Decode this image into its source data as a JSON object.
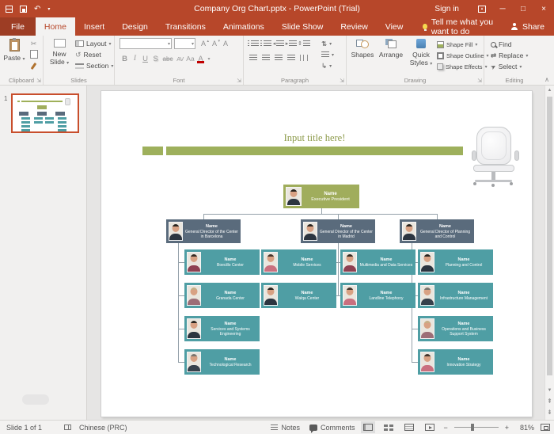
{
  "titlebar": {
    "title": "Company Org Chart.pptx  -  PowerPoint (Trial)",
    "sign_in": "Sign in"
  },
  "tabs": {
    "file": "File",
    "items": [
      "Home",
      "Insert",
      "Design",
      "Transitions",
      "Animations",
      "Slide Show",
      "Review",
      "View"
    ],
    "tell_me": "Tell me what you want to do",
    "share": "Share"
  },
  "ribbon": {
    "groups": [
      "Clipboard",
      "Slides",
      "Font",
      "Paragraph",
      "Drawing",
      "Editing"
    ],
    "clipboard": {
      "paste": "Paste"
    },
    "slides": {
      "new_slide": "New Slide",
      "layout": "Layout",
      "reset": "Reset",
      "section": "Section"
    },
    "font": {
      "bold": "B",
      "italic": "I",
      "underline": "U",
      "shadow": "S",
      "strike": "abc",
      "spacing": "AV",
      "case": "Aa",
      "color": "A",
      "size_letter": "A",
      "font_name_value": "",
      "font_size_value": ""
    },
    "drawing": {
      "shapes": "Shapes",
      "arrange": "Arrange",
      "quick_styles": "Quick Styles",
      "shape_fill": "Shape Fill",
      "shape_outline": "Shape Outline",
      "shape_effects": "Shape Effects"
    },
    "editing": {
      "find": "Find",
      "replace": "Replace",
      "select": "Select"
    }
  },
  "slide_panel": {
    "slide_number": "1"
  },
  "slide": {
    "title": "Input title here!",
    "org_chart": {
      "root": {
        "name": "Name",
        "title": "Executive President",
        "avatar": "man-dark"
      },
      "directors": [
        {
          "name": "Name",
          "title": "General Director of the Center in Barcelona",
          "avatar": "man-dark"
        },
        {
          "name": "Name",
          "title": "General Director of the Center in Madrid",
          "avatar": "man-dark"
        },
        {
          "name": "Name",
          "title": "General Director of Planning and Control",
          "avatar": "man-dark"
        }
      ],
      "columns": [
        {
          "items": [
            {
              "name": "Name",
              "title": "Boecillo Center",
              "avatar": "woman-dark"
            },
            {
              "name": "Name",
              "title": "Granada Center",
              "avatar": "woman-light"
            },
            {
              "name": "Name",
              "title": "Services and Systems Engineering",
              "avatar": "man-dark"
            },
            {
              "name": "Name",
              "title": "Technological Research",
              "avatar": "man-gray"
            }
          ]
        },
        {
          "items": [
            {
              "name": "Name",
              "title": "Mobile Services",
              "avatar": "woman-pink"
            },
            {
              "name": "Name",
              "title": "Walqa Center",
              "avatar": "man-dark"
            }
          ]
        },
        {
          "items": [
            {
              "name": "Name",
              "title": "Multimedia and Data Services",
              "avatar": "woman-dark"
            },
            {
              "name": "Name",
              "title": "Landline Telephony",
              "avatar": "woman-pink"
            }
          ]
        },
        {
          "items": [
            {
              "name": "Name",
              "title": "Planning and Control",
              "avatar": "man-dark"
            },
            {
              "name": "Name",
              "title": "Infrastructure Management",
              "avatar": "man-gray"
            },
            {
              "name": "Name",
              "title": "Operations and Business Support System",
              "avatar": "woman-light"
            },
            {
              "name": "Name",
              "title": "Innovation Strategy",
              "avatar": "woman-pink"
            }
          ]
        }
      ]
    }
  },
  "statusbar": {
    "slide_info": "Slide 1 of 1",
    "language": "Chinese (PRC)",
    "notes": "Notes",
    "comments": "Comments",
    "zoom": "81%"
  },
  "colors": {
    "titlebar": "#B7472A",
    "accent_bar": "#9EB05C",
    "exec_box": "#A0AD5C",
    "director_box": "#5A6B7C",
    "sub_box": "#4F9EA4"
  },
  "icons": {
    "dropdown": "▾",
    "up": "▴",
    "cut": "✂",
    "undo": "↶",
    "reset": "↺",
    "close": "×",
    "minimize": "─",
    "maximize": "□",
    "collapse": "∧",
    "launcher": "⇲",
    "scroll_up": "▲",
    "scroll_down": "▼",
    "prev": "⇞",
    "next": "⇟",
    "zoom_out": "−",
    "zoom_in": "+",
    "swap": "⇄",
    "updown": "⇅",
    "spacing": "⇕",
    "select_arrow": "➤",
    "indent_left": "◂",
    "indent_right": "▸",
    "smartart": "↳"
  }
}
